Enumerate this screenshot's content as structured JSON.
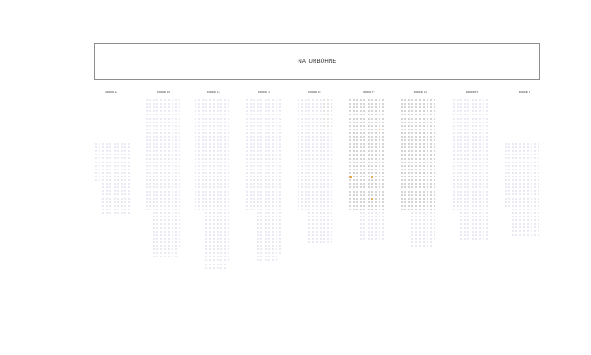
{
  "stage": {
    "label": "NATURBÜHNE"
  },
  "colors": {
    "available": "#e3e3f1",
    "occupied": "#c8c8c8",
    "selected": "#e0952a"
  },
  "blocks": [
    {
      "label": "Block A"
    },
    {
      "label": "Block B"
    },
    {
      "label": "Block C"
    },
    {
      "label": "Block D"
    },
    {
      "label": "Block E"
    },
    {
      "label": "Block F"
    },
    {
      "label": "Block G"
    },
    {
      "label": "Block H"
    },
    {
      "label": "Block I"
    }
  ]
}
